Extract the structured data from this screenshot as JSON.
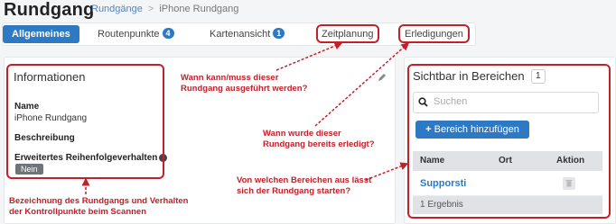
{
  "header": {
    "title": "Rundgang",
    "breadcrumb_parent": "Rundgänge",
    "breadcrumb_separator": ">",
    "breadcrumb_current": "iPhone Rundgang"
  },
  "tabs": [
    {
      "label": "Allgemeines",
      "active": true
    },
    {
      "label": "Routenpunkte",
      "badge": "4"
    },
    {
      "label": "Kartenansicht",
      "badge": "1"
    },
    {
      "label": "Zeitplanung"
    },
    {
      "label": "Erledigungen"
    }
  ],
  "info": {
    "heading": "Informationen",
    "name_label": "Name",
    "name_value": "iPhone Rundgang",
    "desc_label": "Beschreibung",
    "order_label": "Erweitertes Reihenfolgeverhalten",
    "order_value": "Nein",
    "edit_icon": "pencil-icon",
    "info_icon": "info-icon"
  },
  "areas": {
    "heading": "Sichtbar in Bereichen",
    "count": "1",
    "search_placeholder": "Suchen",
    "add_button": "Bereich hinzufügen",
    "add_icon": "plus-icon",
    "columns": [
      "Name",
      "Ort",
      "Aktion"
    ],
    "rows": [
      {
        "name": "Supporsti",
        "ort": ""
      }
    ],
    "footer": "1 Ergebnis"
  },
  "annotations": {
    "zeitplanung": [
      "Wann kann/muss dieser",
      "Rundgang ausgeführt werden?"
    ],
    "erledigungen": [
      "Wann wurde dieser",
      "Rundgang bereits erledigt?"
    ],
    "bereiche": [
      "Von welchen Bereichen aus lässt",
      "sich der Rundgang starten?"
    ],
    "informationen": [
      "Bezeichnung des Rundgangs und Verhalten",
      "der Kontrollpunkte beim Scannen"
    ]
  },
  "colors": {
    "accent": "#2e79c4",
    "annotation_red": "#c4202a",
    "table_header": "#dfe3e6"
  }
}
